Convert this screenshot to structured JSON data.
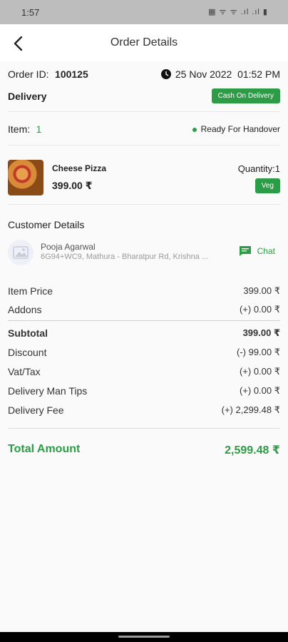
{
  "status": {
    "time": "1:57",
    "icons": "▦ ᯤ ᯤ .ıl .ıl ▮"
  },
  "header": {
    "title": "Order Details"
  },
  "order": {
    "id_label": "Order ID:",
    "id_value": "100125",
    "date": "25 Nov 2022",
    "time": "01:52 PM",
    "type": "Delivery",
    "payment_badge": "Cash On Delivery",
    "item_label": "Item:",
    "item_count": "1",
    "status": "Ready For Handover"
  },
  "item": {
    "name": "Cheese Pizza",
    "price": "399.00 ₹",
    "quantity": "Quantity:1",
    "tag": "Veg"
  },
  "customer": {
    "section_title": "Customer Details",
    "name": "Pooja Agarwal",
    "address": "6G94+WC9, Mathura - Bharatpur Rd, Krishna ...",
    "chat_label": "Chat"
  },
  "summary": {
    "item_price_label": "Item Price",
    "item_price": "399.00 ₹",
    "addons_label": "Addons",
    "addons": "(+) 0.00 ₹",
    "subtotal_label": "Subtotal",
    "subtotal": "399.00 ₹",
    "discount_label": "Discount",
    "discount": "(-) 99.00 ₹",
    "vat_label": "Vat/Tax",
    "vat": "(+) 0.00 ₹",
    "tips_label": "Delivery Man Tips",
    "tips": "(+) 0.00 ₹",
    "fee_label": "Delivery Fee",
    "fee": "(+) 2,299.48 ₹",
    "total_label": "Total Amount",
    "total": "2,599.48 ₹"
  },
  "colors": {
    "accent": "#2d9c46"
  }
}
